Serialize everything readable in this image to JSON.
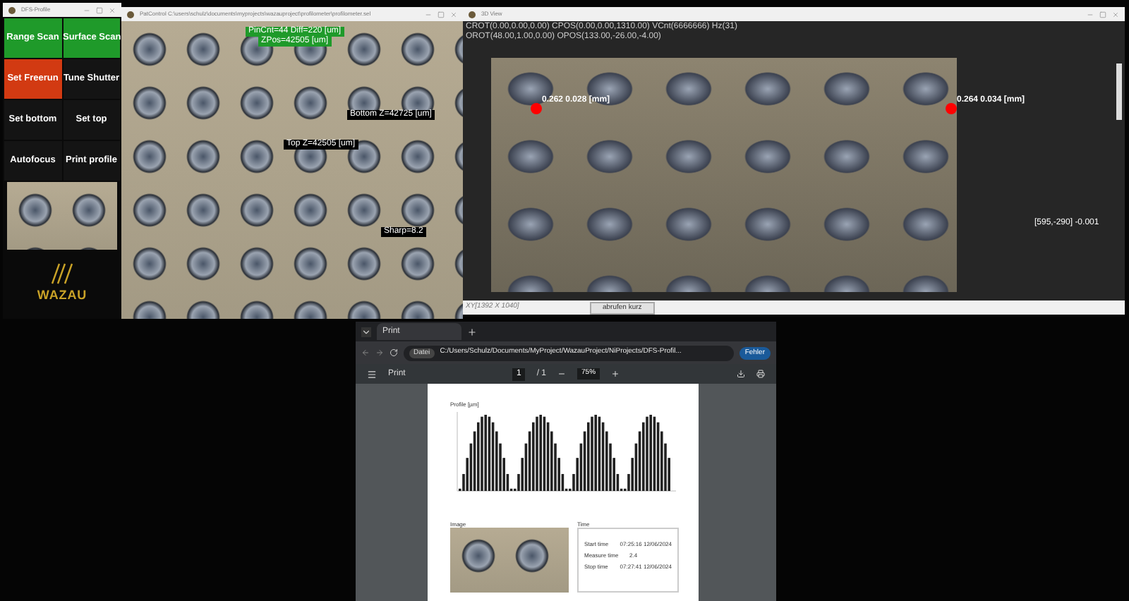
{
  "profile_window": {
    "title": "DFS-Profile",
    "buttons": [
      {
        "label": "Range Scan",
        "color": "#1f9a2a"
      },
      {
        "label": "Surface Scan",
        "color": "#1f9a2a"
      },
      {
        "label": "Set Freerun",
        "color": "#d23a12"
      },
      {
        "label": "Tune Shutter",
        "color": "#141414"
      },
      {
        "label": "Set bottom",
        "color": "#141414"
      },
      {
        "label": "Set top",
        "color": "#141414"
      },
      {
        "label": "Autofocus",
        "color": "#141414"
      },
      {
        "label": "Print profile",
        "color": "#141414"
      }
    ],
    "logo": "WAZAU"
  },
  "camera_window": {
    "title": "PatControl C:\\users\\schulz\\documents\\myprojects\\wazauproject\\profilometer\\profilometer.sel",
    "status_lines": [
      "PinCnt=44 Diff=220 [um]",
      "ZPos=42505 [um]"
    ],
    "markers": [
      {
        "label": "Bottom Z=42725 [um]"
      },
      {
        "label": "Top Z=42505 [um]"
      },
      {
        "label": "Sharp=8.2"
      }
    ]
  },
  "view3d_window": {
    "title": "3D View",
    "info_lines": [
      "CROT(0.00,0.00,0.00) CPOS(0.00,0.00,1310.00) VCnt(6666666) Hz(31)",
      "OROT(48.00,1.00,0.00) OPOS(133.00,-26.00,-4.00)"
    ],
    "points": [
      {
        "label": "0.262 0.028 [mm]"
      },
      {
        "label": "0.264 0.034 [mm]"
      }
    ],
    "cursor_label": "[595,-290] -0.001",
    "resolution": "XY[1392 X 1040]",
    "footer_button": "abrufen kurz"
  },
  "browser": {
    "tab": "Print",
    "address_chip": "Datei",
    "address": "C:/Users/Schulz/Documents/MyProject/WazauProject/NiProjects/DFS-Profil...",
    "profile_button": "Fehler",
    "pdf_toolbar": {
      "title": "Print",
      "page": "1",
      "page_total": "/ 1",
      "zoom": "75%"
    },
    "document": {
      "chart_title": "Profile [µm]",
      "image_title": "Image",
      "time_title": "Time",
      "times": [
        {
          "label": "Start time",
          "value": "07:25:16  12/06/2024"
        },
        {
          "label": "Measure time",
          "value": "2.4"
        },
        {
          "label": "Stop time",
          "value": "07:27:41  12/06/2024"
        }
      ]
    }
  }
}
